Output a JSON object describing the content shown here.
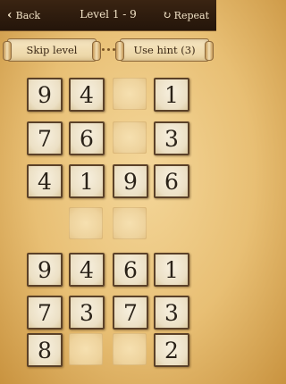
{
  "header": {
    "back_label": "Back",
    "title": "Level 1 - 9",
    "repeat_label": "Repeat",
    "back_icon": "chevron-left-icon",
    "repeat_icon": "refresh-icon"
  },
  "actions": {
    "skip_label": "Skip level",
    "hint_label": "Use hint (3)"
  },
  "board": {
    "rows": [
      [
        "9",
        "4",
        "",
        "1"
      ],
      [
        "7",
        "6",
        "",
        "3"
      ],
      [
        "4",
        "1",
        "9",
        "6"
      ],
      [
        null,
        "",
        "",
        null
      ],
      [
        "9",
        "4",
        "6",
        "1"
      ],
      [
        "7",
        "3",
        "7",
        "3"
      ],
      [
        "8",
        "",
        "",
        "2"
      ]
    ]
  },
  "colors": {
    "tile_border": "#5b4128",
    "tile_face": "#f7f0df",
    "background": "#e8bf74",
    "topbar": "#24150a"
  }
}
